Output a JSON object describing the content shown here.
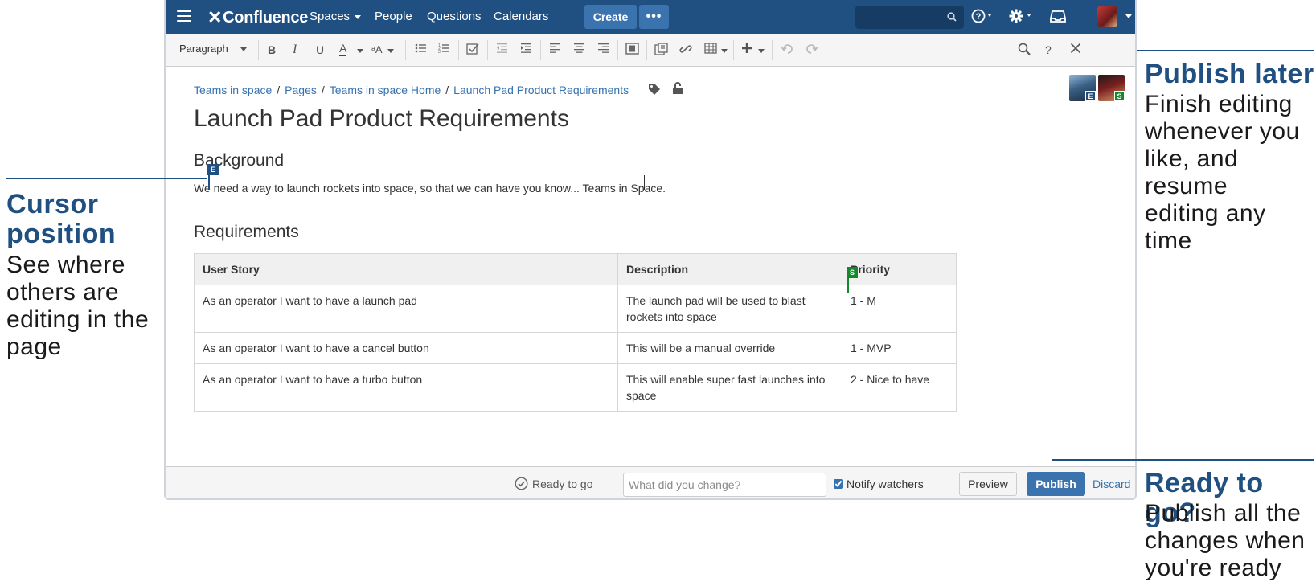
{
  "nav": {
    "logo": "Confluence",
    "spaces": "Spaces",
    "people": "People",
    "questions": "Questions",
    "calendars": "Calendars",
    "create": "Create",
    "more": "•••"
  },
  "toolbar": {
    "paragraph": "Paragraph",
    "bold": "B",
    "italic": "I",
    "underline": "U",
    "text_color": "A",
    "formatting": "ᵃA",
    "help": "?"
  },
  "breadcrumb": [
    "Teams in space",
    "Pages",
    "Teams in space Home",
    "Launch Pad Product Requirements"
  ],
  "page": {
    "title": "Launch Pad Product Requirements",
    "background_heading": "Background",
    "background_text": "We need a way to launch rockets into space, so that we can have you know... Teams in Space.",
    "requirements_heading": "Requirements"
  },
  "table": {
    "headers": [
      "User Story",
      "Description",
      "Priority"
    ],
    "rows": [
      [
        "As an operator I want to have a launch pad",
        "The launch pad will be used to blast rockets into space",
        "1 - M"
      ],
      [
        "As an operator I want to have a cancel button",
        "This will be a manual override",
        "1 - MVP"
      ],
      [
        "As an operator I want to have a turbo button",
        "This will enable super fast launches into space",
        "2 - Nice to have"
      ]
    ]
  },
  "collaborators": {
    "badge_e": "E",
    "badge_s": "S"
  },
  "footer": {
    "status": "Ready to go",
    "change_placeholder": "What did you change?",
    "notify_label": "Notify watchers",
    "notify_checked": true,
    "preview": "Preview",
    "publish": "Publish",
    "discard": "Discard"
  },
  "callouts": {
    "publish_later": {
      "title": "Publish later",
      "body": [
        "Finish editing",
        "whenever you",
        "like, and resume",
        "editing any time"
      ]
    },
    "cursor": {
      "title": [
        "Cursor",
        "position"
      ],
      "body": [
        "See where",
        "others are",
        "editing in the",
        "page"
      ]
    },
    "ready": {
      "title": "Ready to go?",
      "body": [
        "Publish all the",
        "changes when",
        "you're ready"
      ]
    }
  },
  "colors": {
    "nav": "#205081",
    "accent": "#3b73af",
    "link": "#3572b0",
    "badge_e": "#205081",
    "badge_s": "#14892c"
  }
}
